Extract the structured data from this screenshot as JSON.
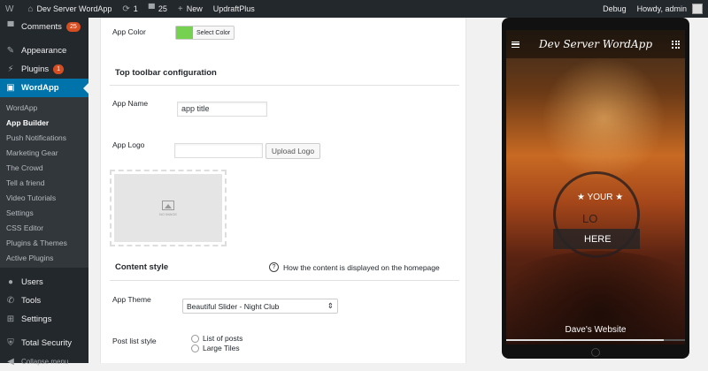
{
  "adminbar": {
    "site_name": "Dev Server WordApp",
    "updates_count": "1",
    "comments_count": "25",
    "new_label": "New",
    "plugin_label": "UpdraftPlus",
    "debug_label": "Debug",
    "howdy_label": "Howdy, admin"
  },
  "sidebar": {
    "comments": {
      "label": "Comments",
      "badge": "25"
    },
    "appearance": "Appearance",
    "plugins": {
      "label": "Plugins",
      "badge": "1"
    },
    "wordapp": "WordApp",
    "submenu": [
      "WordApp",
      "App Builder",
      "Push Notifications",
      "Marketing Gear",
      "The Crowd",
      "Tell a friend",
      "Video Tutorials",
      "Settings",
      "CSS Editor",
      "Plugins & Themes",
      "Active Plugins"
    ],
    "users": "Users",
    "tools": "Tools",
    "settings": "Settings",
    "total_security": "Total Security",
    "collapse": "Collapse menu"
  },
  "form": {
    "app_color_label": "App Color",
    "select_color_label": "Select Color",
    "toolbar_section_title": "Top toolbar configuration",
    "app_name_label": "App Name",
    "app_name_value": "app title",
    "app_logo_label": "App Logo",
    "upload_logo_label": "Upload Logo",
    "no_image_text": "NO IMAGE",
    "content_section_title": "Content style",
    "content_help_text": "How the content is displayed on the homepage",
    "app_theme_label": "App Theme",
    "app_theme_value": "Beautiful Slider - Night Club",
    "post_list_label": "Post list style",
    "post_list_options": [
      "List of posts",
      "Large Tiles"
    ]
  },
  "preview": {
    "app_title": "Dev Server WordApp",
    "logo_your": "YOUR",
    "logo_lo": "LO",
    "logo_here": "HERE",
    "site_name": "Dave's Website",
    "slider_progress": 0.88
  },
  "colors": {
    "admin_dark": "#23282d",
    "accent": "#0073aa",
    "badge": "#d54e21",
    "app_color": "#75d14f"
  }
}
